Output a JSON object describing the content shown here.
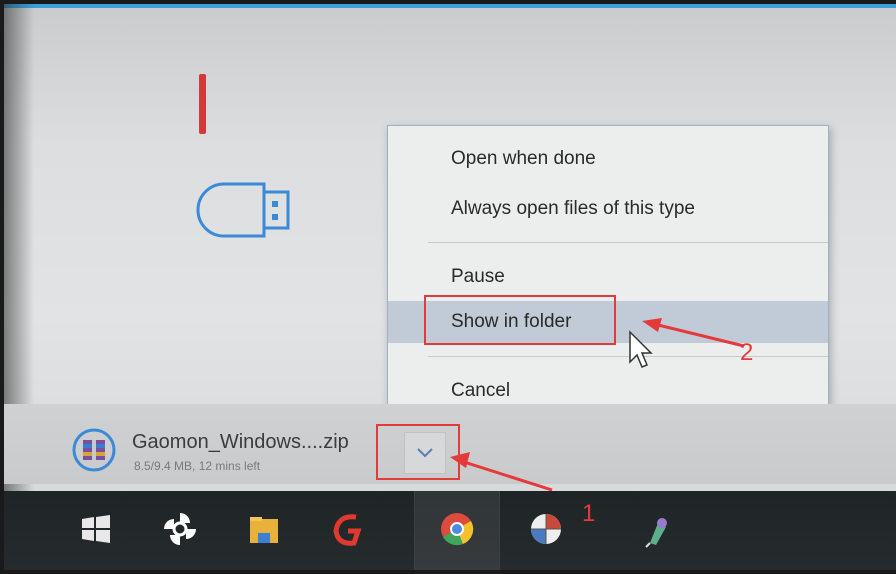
{
  "context_menu": {
    "items": [
      {
        "label": "Open when done"
      },
      {
        "label": "Always open files of this type"
      },
      {
        "label": "Pause"
      },
      {
        "label": "Show in folder"
      },
      {
        "label": "Cancel"
      }
    ]
  },
  "download": {
    "filename": "Gaomon_Windows....zip",
    "status": "8.5/9.4 MB, 12 mins left"
  },
  "annotations": {
    "label_1": "1",
    "label_2": "2",
    "highlight_color": "#e43a3a"
  },
  "taskbar": {
    "icons": [
      "windows-start-icon",
      "pinwheel-app-icon",
      "file-explorer-icon",
      "red-app-icon",
      "chrome-icon",
      "globe-app-icon",
      "pen-app-icon"
    ]
  }
}
